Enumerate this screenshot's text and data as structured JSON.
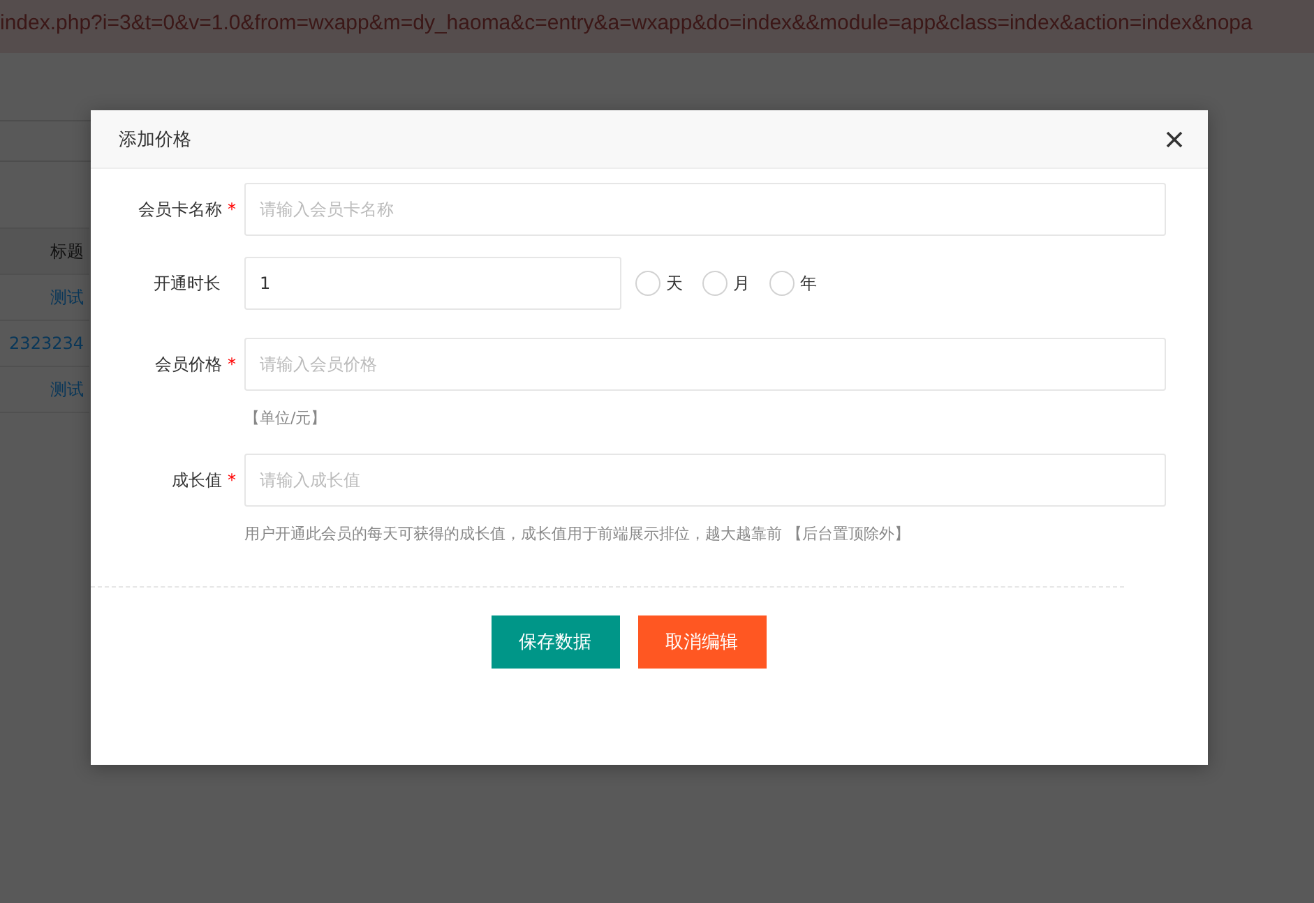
{
  "address_bar": {
    "url": "index.php?i=3&t=0&v=1.0&from=wxapp&m=dy_haoma&c=entry&a=wxapp&do=index&&module=app&class=index&action=index&nopa"
  },
  "table": {
    "columns": [
      "标题"
    ],
    "rows": [
      [
        "测试"
      ],
      [
        "2323234"
      ],
      [
        "测试"
      ]
    ]
  },
  "dialog": {
    "title": "添加价格",
    "fields": [
      {
        "kind": "text",
        "label": "会员卡名称",
        "required_mark": "*",
        "placeholder": "请输入会员卡名称"
      },
      {
        "kind": "duration",
        "label": "开通时长",
        "value": "1",
        "options": [
          {
            "label": "天",
            "selected": false
          },
          {
            "label": "月",
            "selected": false
          },
          {
            "label": "年",
            "selected": false
          }
        ]
      },
      {
        "kind": "text",
        "label": "会员价格",
        "required_mark": "*",
        "placeholder": "请输入会员价格",
        "hint": "【单位/元】"
      },
      {
        "kind": "text",
        "label": "成长值",
        "required_mark": "*",
        "placeholder": "请输入成长值",
        "hint": "用户开通此会员的每天可获得的成长值，成长值用于前端展示排位，越大越靠前 【后台置顶除外】"
      }
    ],
    "buttons": [
      {
        "label": "保存数据",
        "kind": "primary"
      },
      {
        "label": "取消编辑",
        "kind": "danger"
      }
    ]
  }
}
